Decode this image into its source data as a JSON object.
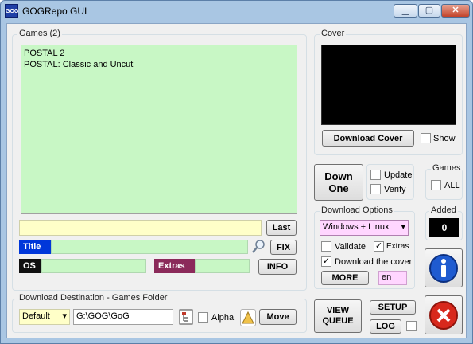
{
  "window": {
    "title": "GOGRepo GUI",
    "icon_text": "GOG",
    "min_glyph": "▁",
    "max_glyph": "▢",
    "close_glyph": "✕"
  },
  "games_panel": {
    "title": "Games  (2)",
    "list": [
      "POSTAL 2",
      "POSTAL: Classic and Uncut"
    ],
    "last_label": "Last",
    "title_tag": "Title",
    "fix_label": "FIX",
    "os_tag": "OS",
    "extras_tag": "Extras",
    "info_label": "INFO"
  },
  "cover_panel": {
    "title": "Cover",
    "download_label": "Download Cover",
    "show_label": "Show"
  },
  "download_one": {
    "label_line1": "Down",
    "label_line2": "One",
    "update_label": "Update",
    "verify_label": "Verify"
  },
  "games_counter": {
    "title": "Games",
    "all_label": "ALL"
  },
  "added_panel": {
    "title": "Added",
    "value": "0"
  },
  "download_options": {
    "title": "Download Options",
    "os_selected": "Windows + Linux",
    "validate_label": "Validate",
    "extras_label": "Extras",
    "download_cover_label": "Download the cover",
    "more_label": "MORE",
    "lang_value": "en"
  },
  "destination": {
    "title": "Download Destination - Games Folder",
    "preset_selected": "Default",
    "path": "G:\\GOG\\GoG",
    "alpha_label": "Alpha",
    "move_label": "Move"
  },
  "actions": {
    "view_queue_line1": "VIEW",
    "view_queue_line2": "QUEUE",
    "setup_label": "SETUP",
    "log_label": "LOG"
  },
  "colors": {
    "list_bg": "#c8f7c5",
    "title_bar_fill": "#ffffc8",
    "title_tag": "#0037da",
    "os_tag": "#101010",
    "extras_tag": "#8b2a5a",
    "lang_bg": "#ffd6ff"
  }
}
